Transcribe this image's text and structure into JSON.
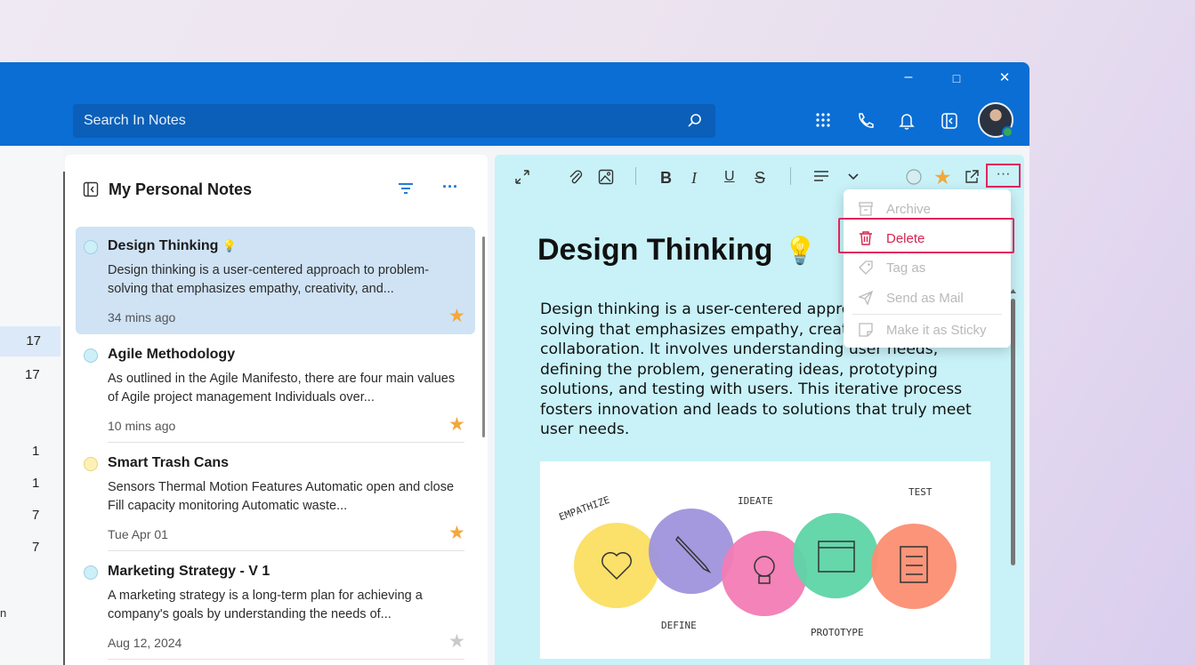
{
  "app": {
    "window_controls": [
      "–",
      "□",
      "✕"
    ],
    "search": {
      "placeholder": "Search In Notes"
    },
    "top_icons": [
      "grid-icon",
      "phone-icon",
      "bell-icon",
      "panel-icon"
    ],
    "avatar_status": "online"
  },
  "leftnav": {
    "counts": [
      "17",
      "17",
      "1",
      "1",
      "7",
      "7"
    ],
    "selected_index": 0,
    "fragment": "n"
  },
  "list": {
    "title": "My Personal Notes",
    "more_label": "···",
    "notes": [
      {
        "title": "Design Thinking",
        "emoji": "💡",
        "body": "Design thinking is a user-centered approach to problem-solving that emphasizes empathy, creativity, and...",
        "time": "34 mins ago",
        "starred": true,
        "dot": "teal",
        "active": true
      },
      {
        "title": "Agile Methodology",
        "emoji": "",
        "body": "As outlined in the Agile Manifesto, there are four main values of Agile project management Individuals over...",
        "time": "10 mins ago",
        "starred": true,
        "dot": "teal",
        "active": false
      },
      {
        "title": "Smart Trash Cans",
        "emoji": "",
        "body": "Sensors Thermal Motion Features Automatic open and close Fill capacity monitoring Automatic waste...",
        "time": "Tue Apr 01",
        "starred": true,
        "dot": "yellow",
        "active": false
      },
      {
        "title": "Marketing Strategy - V 1",
        "emoji": "",
        "body": "A marketing strategy is a long-term plan for achieving a company's goals by understanding the needs of...",
        "time": "Aug 12, 2024",
        "starred": false,
        "dot": "teal",
        "active": false
      }
    ]
  },
  "editor": {
    "toolbar": {
      "bold": "B",
      "italic": "I",
      "underline": "U",
      "strike": "S",
      "more": "···"
    },
    "title": "Design Thinking",
    "title_emoji": "💡",
    "body": "Design thinking is a user-centered approach to problem-solving that emphasizes empathy, creativity, and collaboration. It involves understanding user needs, defining the problem, generating ideas, prototyping solutions, and testing with users. This iterative process fosters innovation and leads to solutions that truly meet user needs.",
    "illustration": {
      "labels": [
        "EMPATHIZE",
        "DEFINE",
        "IDEATE",
        "PROTOTYPE",
        "TEST"
      ],
      "colors": [
        "#fbe06a",
        "#9f94dc",
        "#f27cb4",
        "#5ed4a6",
        "#fb8e72"
      ]
    }
  },
  "context_menu": {
    "items": [
      {
        "label": "Archive",
        "icon": "archive-icon",
        "enabled": false
      },
      {
        "label": "Delete",
        "icon": "trash-icon",
        "enabled": true
      },
      {
        "label": "Tag as",
        "icon": "tag-icon",
        "enabled": false
      },
      {
        "label": "Send as Mail",
        "icon": "send-icon",
        "enabled": false
      },
      {
        "label": "Make it as Sticky",
        "icon": "sticky-icon",
        "enabled": false
      }
    ]
  },
  "colors": {
    "accent": "#0a6ed4",
    "editor_bg": "#c8f2f8",
    "highlight": "#e3245c",
    "star": "#f3a83b"
  }
}
